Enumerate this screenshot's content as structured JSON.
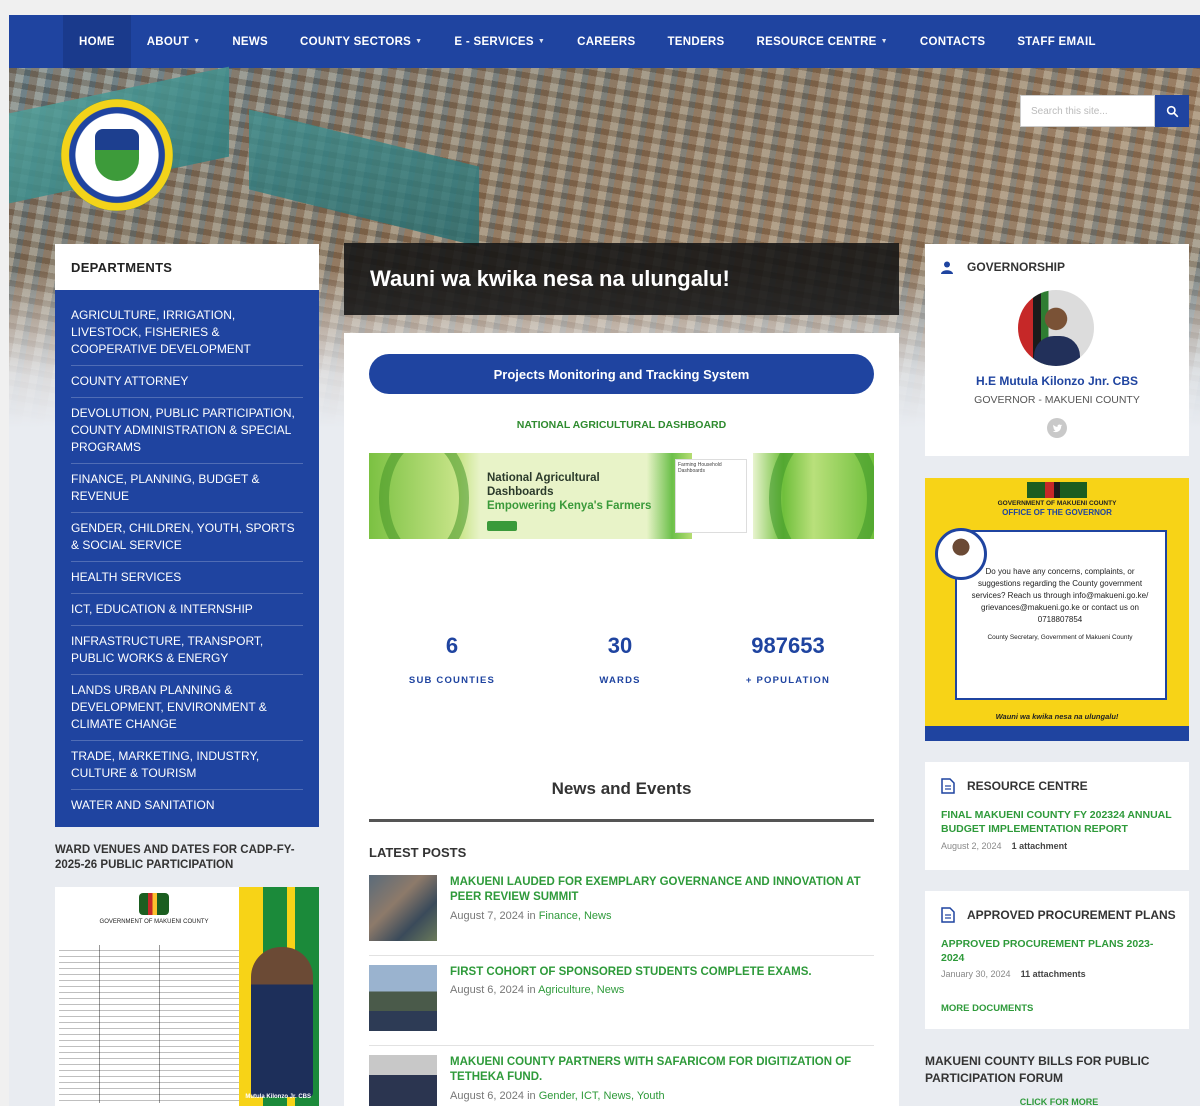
{
  "nav": {
    "items": [
      {
        "label": "HOME",
        "dropdown": false,
        "active": true
      },
      {
        "label": "ABOUT",
        "dropdown": true,
        "active": false
      },
      {
        "label": "NEWS",
        "dropdown": false,
        "active": false
      },
      {
        "label": "COUNTY SECTORS",
        "dropdown": true,
        "active": false
      },
      {
        "label": "E - SERVICES",
        "dropdown": true,
        "active": false
      },
      {
        "label": "CAREERS",
        "dropdown": false,
        "active": false
      },
      {
        "label": "TENDERS",
        "dropdown": false,
        "active": false
      },
      {
        "label": "RESOURCE CENTRE",
        "dropdown": true,
        "active": false
      },
      {
        "label": "CONTACTS",
        "dropdown": false,
        "active": false
      },
      {
        "label": "STAFF EMAIL",
        "dropdown": false,
        "active": false
      }
    ]
  },
  "search": {
    "placeholder": "Search this site..."
  },
  "departments": {
    "heading": "DEPARTMENTS",
    "items": [
      "AGRICULTURE, IRRIGATION, LIVESTOCK, FISHERIES & COOPERATIVE DEVELOPMENT",
      "COUNTY ATTORNEY",
      "DEVOLUTION, PUBLIC PARTICIPATION, COUNTY ADMINISTRATION & SPECIAL PROGRAMS",
      "FINANCE, PLANNING, BUDGET & REVENUE",
      "GENDER, CHILDREN, YOUTH, SPORTS & SOCIAL SERVICE",
      "HEALTH SERVICES",
      "ICT, EDUCATION & INTERNSHIP",
      "INFRASTRUCTURE, TRANSPORT, PUBLIC WORKS & ENERGY",
      "LANDS URBAN PLANNING & DEVELOPMENT, ENVIRONMENT & CLIMATE CHANGE",
      "TRADE, MARKETING, INDUSTRY, CULTURE & TOURISM",
      "WATER AND SANITATION"
    ]
  },
  "ward": {
    "title": "WARD VENUES AND DATES FOR CADP-FY-2025-26 PUBLIC PARTICIPATION",
    "poster_header": "GOVERNMENT OF MAKUENI COUNTY",
    "poster_name": "Mutula Kilonzo Jr. CBS"
  },
  "banner": {
    "tagline": "Wauni wa kwika nesa na ulungalu!"
  },
  "center": {
    "pmts_label": "Projects Monitoring and Tracking System",
    "nad_label": "NATIONAL AGRICULTURAL DASHBOARD",
    "nad_banner_line1": "National Agricultural",
    "nad_banner_line2": "Dashboards",
    "nad_banner_line3": "Empowering Kenya's Farmers",
    "nad_screen_text": "Farming Household Dashboards",
    "stats": [
      {
        "value": "6",
        "label": "SUB COUNTIES"
      },
      {
        "value": "30",
        "label": "WARDS"
      },
      {
        "value": "987653",
        "label": "+ POPULATION"
      }
    ],
    "news_heading": "News and Events",
    "latest_heading": "LATEST POSTS",
    "posts": [
      {
        "title": "MAKUENI LAUDED FOR EXEMPLARY GOVERNANCE AND INNOVATION AT PEER REVIEW SUMMIT",
        "date": "August 7, 2024",
        "in": "in",
        "categories": "Finance, News"
      },
      {
        "title": "FIRST COHORT OF SPONSORED STUDENTS COMPLETE EXAMS.",
        "date": "August 6, 2024",
        "in": "in",
        "categories": "Agriculture, News"
      },
      {
        "title": "MAKUENI COUNTY PARTNERS WITH SAFARICOM FOR DIGITIZATION OF TETHEKA FUND.",
        "date": "August 6, 2024",
        "in": "in",
        "categories": "Gender, ICT, News, Youth"
      }
    ]
  },
  "governorship": {
    "heading": "GOVERNORSHIP",
    "name": "H.E Mutula Kilonzo Jnr. CBS",
    "title": "GOVERNOR - MAKUENI COUNTY"
  },
  "gov_poster": {
    "line1": "GOVERNMENT OF MAKUENI COUNTY",
    "line2": "OFFICE OF THE GOVERNOR",
    "body": "Do you have any concerns, complaints, or suggestions regarding the County government services? Reach us through info@makueni.go.ke/ grievances@makueni.go.ke or contact us on 0718807854",
    "signoff": "County Secretary, Government of Makueni County",
    "footer": "Wauni wa kwika nesa na ulungalu!"
  },
  "resource": {
    "heading": "RESOURCE CENTRE",
    "doc_title": "FINAL MAKUENI COUNTY FY 202324 ANNUAL BUDGET IMPLEMENTATION REPORT",
    "date": "August 2, 2024",
    "attachments": "1 attachment"
  },
  "procurement": {
    "heading": "APPROVED PROCUREMENT PLANS",
    "doc_title": "APPROVED PROCUREMENT PLANS 2023-2024",
    "date": "January 30, 2024",
    "attachments": "11 attachments",
    "more": "MORE DOCUMENTS"
  },
  "bills": {
    "title": "MAKUENI COUNTY BILLS FOR PUBLIC PARTICIPATION FORUM",
    "button": "CLICK FOR MORE"
  },
  "colors": {
    "primary": "#1f44a0",
    "accent_green": "#2e9a3a",
    "yellow": "#f7d317"
  }
}
